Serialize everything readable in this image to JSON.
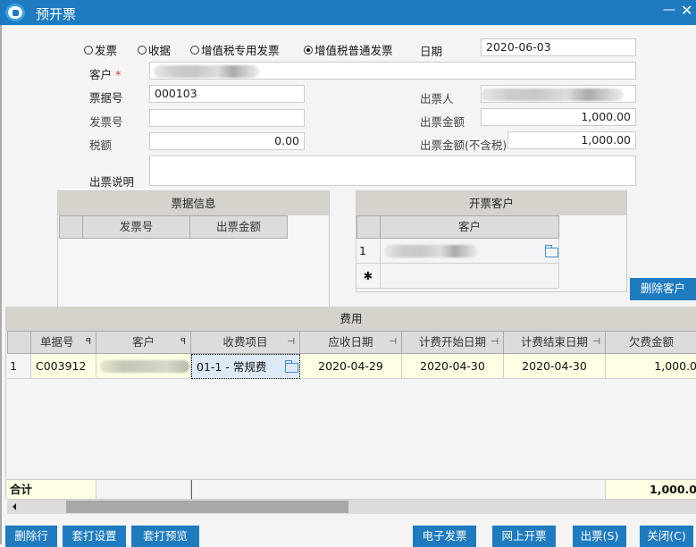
{
  "window": {
    "title": "预开票",
    "minimize": "—",
    "close": "✕"
  },
  "invoice_types": [
    {
      "label": "发票",
      "selected": false
    },
    {
      "label": "收据",
      "selected": false
    },
    {
      "label": "增值税专用发票",
      "selected": false
    },
    {
      "label": "增值税普通发票",
      "selected": true
    }
  ],
  "form": {
    "date_label": "日期",
    "date_value": "2020-06-03",
    "customer_label": "客户",
    "customer_required": "*",
    "customer_value": "",
    "receipt_no_label": "票据号",
    "receipt_no_value": "000103",
    "issuer_label": "出票人",
    "issuer_value": "",
    "invoice_no_label": "发票号",
    "invoice_no_value": "",
    "amount_label": "出票金额",
    "amount_value": "1,000.00",
    "tax_label": "税额",
    "tax_value": "0.00",
    "amount_excl_tax_label": "出票金额(不含税)",
    "amount_excl_tax_value": "1,000.00",
    "note_label": "出票说明",
    "note_value": ""
  },
  "receipt_info": {
    "title": "票据信息",
    "columns": [
      "发票号",
      "出票金额"
    ]
  },
  "billing_customers": {
    "title": "开票客户",
    "columns": [
      "客户"
    ],
    "rows": [
      {
        "index": "1",
        "customer": ""
      }
    ],
    "new_row_marker": "✱",
    "delete_button": "删除客户"
  },
  "fees": {
    "title": "费用",
    "columns": [
      "单据号",
      "客户",
      "收费项目",
      "应收日期",
      "计费开始日期",
      "计费结束日期",
      "欠费金额"
    ],
    "rows": [
      {
        "index": "1",
        "doc_no": "C003912",
        "customer": "",
        "fee_item": "01-1 - 常规费",
        "due_date": "2020-04-29",
        "start_date": "2020-04-30",
        "end_date": "2020-04-30",
        "amount": "1,000.0"
      }
    ],
    "total_label": "合计",
    "total_amount": "1,000.0"
  },
  "buttons": {
    "delete_row": "删除行",
    "print_setup": "套打设置",
    "print_preview": "套打预览",
    "e_invoice": "电子发票",
    "online_invoice": "网上开票",
    "issue": "出票(S)",
    "close": "关闭(C)"
  }
}
